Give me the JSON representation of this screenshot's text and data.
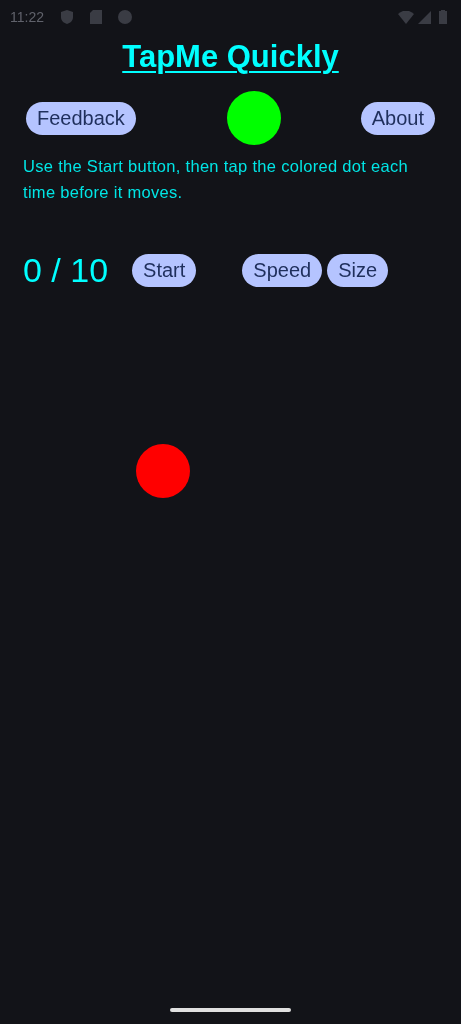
{
  "status_bar": {
    "time": "11:22"
  },
  "title": "TapMe Quickly",
  "top_buttons": [
    {
      "label": "Feedback"
    },
    {
      "label": "About"
    }
  ],
  "indicator_dot": {
    "color": "#00ff00"
  },
  "instructions": "Use the Start button, then tap the colored dot each time before it moves.",
  "score": "0 / 10",
  "controls": [
    {
      "label": "Start"
    },
    {
      "label": "Speed"
    },
    {
      "label": "Size"
    }
  ],
  "target_dot": {
    "color": "#ff0000"
  }
}
